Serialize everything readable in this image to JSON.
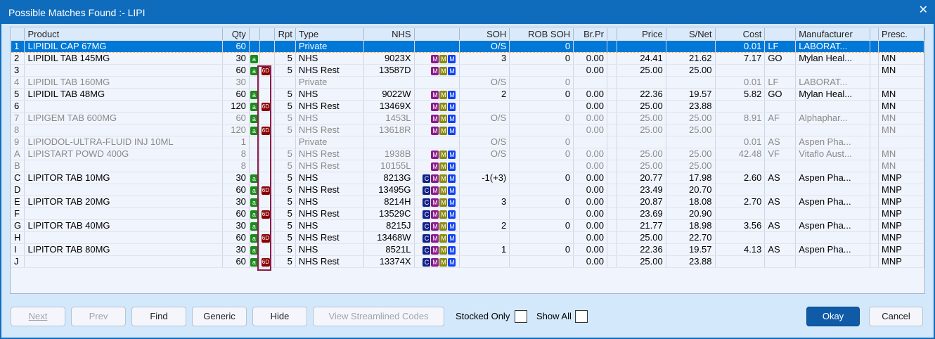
{
  "window": {
    "title": "Possible Matches Found :- LIPI",
    "close": "✕"
  },
  "columns": [
    "",
    "Product",
    "Qty",
    "",
    "",
    "Rpt",
    "Type",
    "NHS",
    "",
    "SOH",
    "ROB SOH",
    "Br.Pr",
    "",
    "Price",
    "S/Net",
    "Cost",
    "",
    "Manufacturer",
    "",
    "Presc."
  ],
  "rows": [
    {
      "id": "1",
      "product": "LIPIDIL CAP 67MG",
      "qty": "60",
      "a": false,
      "sixd": false,
      "rpt": "",
      "type": "Private",
      "nhs": "",
      "icons": "",
      "soh": "O/S",
      "rob": "0",
      "brpr": "",
      "price": "",
      "snet": "",
      "cost": "0.01",
      "code": "LF",
      "mfr": "LABORAT...",
      "presc": "",
      "state": "selected"
    },
    {
      "id": "2",
      "product": "LIPIDIL TAB 145MG",
      "qty": "30",
      "a": true,
      "sixd": false,
      "rpt": "5",
      "type": "NHS",
      "nhs": "9023X",
      "icons": "MMM",
      "soh": "3",
      "rob": "0",
      "brpr": "0.00",
      "price": "24.41",
      "snet": "21.62",
      "cost": "7.17",
      "code": "GO",
      "mfr": "Mylan Heal...",
      "presc": "MN",
      "state": ""
    },
    {
      "id": "3",
      "product": "",
      "qty": "60",
      "a": true,
      "sixd": true,
      "rpt": "5",
      "type": "NHS  Rest",
      "nhs": "13587D",
      "icons": "MMM",
      "soh": "",
      "rob": "",
      "brpr": "0.00",
      "price": "25.00",
      "snet": "25.00",
      "cost": "",
      "code": "",
      "mfr": "",
      "presc": "MN",
      "state": ""
    },
    {
      "id": "4",
      "product": "LIPIDIL TAB 160MG",
      "qty": "30",
      "a": false,
      "sixd": false,
      "rpt": "",
      "type": "Private",
      "nhs": "",
      "icons": "",
      "soh": "O/S",
      "rob": "0",
      "brpr": "",
      "price": "",
      "snet": "",
      "cost": "0.01",
      "code": "LF",
      "mfr": "LABORAT...",
      "presc": "",
      "state": "grey"
    },
    {
      "id": "5",
      "product": "LIPIDIL TAB 48MG",
      "qty": "60",
      "a": true,
      "sixd": false,
      "rpt": "5",
      "type": "NHS",
      "nhs": "9022W",
      "icons": "MMM",
      "soh": "2",
      "rob": "0",
      "brpr": "0.00",
      "price": "22.36",
      "snet": "19.57",
      "cost": "5.82",
      "code": "GO",
      "mfr": "Mylan Heal...",
      "presc": "MN",
      "state": ""
    },
    {
      "id": "6",
      "product": "",
      "qty": "120",
      "a": true,
      "sixd": true,
      "rpt": "5",
      "type": "NHS  Rest",
      "nhs": "13469X",
      "icons": "MMM",
      "soh": "",
      "rob": "",
      "brpr": "0.00",
      "price": "25.00",
      "snet": "23.88",
      "cost": "",
      "code": "",
      "mfr": "",
      "presc": "MN",
      "state": ""
    },
    {
      "id": "7",
      "product": "LIPIGEM TAB 600MG",
      "qty": "60",
      "a": true,
      "sixd": false,
      "rpt": "5",
      "type": "NHS",
      "nhs": "1453L",
      "icons": "MMM",
      "soh": "O/S",
      "rob": "0",
      "brpr": "0.00",
      "price": "25.00",
      "snet": "25.00",
      "cost": "8.91",
      "code": "AF",
      "mfr": "Alphaphar...",
      "presc": "MN",
      "state": "grey"
    },
    {
      "id": "8",
      "product": "",
      "qty": "120",
      "a": true,
      "sixd": true,
      "rpt": "5",
      "type": "NHS  Rest",
      "nhs": "13618R",
      "icons": "MMM",
      "soh": "",
      "rob": "",
      "brpr": "0.00",
      "price": "25.00",
      "snet": "25.00",
      "cost": "",
      "code": "",
      "mfr": "",
      "presc": "MN",
      "state": "grey"
    },
    {
      "id": "9",
      "product": "LIPIODOL-ULTRA-FLUID INJ 10ML",
      "qty": "1",
      "a": false,
      "sixd": false,
      "rpt": "",
      "type": "Private",
      "nhs": "",
      "icons": "",
      "soh": "O/S",
      "rob": "0",
      "brpr": "",
      "price": "",
      "snet": "",
      "cost": "0.01",
      "code": "AS",
      "mfr": "Aspen Pha...",
      "presc": "",
      "state": "grey"
    },
    {
      "id": "A",
      "product": "LIPISTART POWD 400G",
      "qty": "8",
      "a": false,
      "sixd": false,
      "rpt": "5",
      "type": "NHS  Rest",
      "nhs": "1938B",
      "icons": "MMM",
      "soh": "O/S",
      "rob": "0",
      "brpr": "0.00",
      "price": "25.00",
      "snet": "25.00",
      "cost": "42.48",
      "code": "VF",
      "mfr": "Vitaflo Aust...",
      "presc": "MN",
      "state": "grey"
    },
    {
      "id": "B",
      "product": "",
      "qty": "8",
      "a": false,
      "sixd": false,
      "rpt": "5",
      "type": "NHS  Rest",
      "nhs": "10155L",
      "icons": "MMM",
      "soh": "",
      "rob": "",
      "brpr": "0.00",
      "price": "25.00",
      "snet": "25.00",
      "cost": "",
      "code": "",
      "mfr": "",
      "presc": "MN",
      "state": "grey"
    },
    {
      "id": "C",
      "product": "LIPITOR TAB 10MG",
      "qty": "30",
      "a": true,
      "sixd": false,
      "rpt": "5",
      "type": "NHS",
      "nhs": "8213G",
      "icons": "CMMM",
      "soh": "-1(+3)",
      "rob": "0",
      "brpr": "0.00",
      "price": "20.77",
      "snet": "17.98",
      "cost": "2.60",
      "code": "AS",
      "mfr": "Aspen Pha...",
      "presc": "MNP",
      "state": ""
    },
    {
      "id": "D",
      "product": "",
      "qty": "60",
      "a": true,
      "sixd": true,
      "rpt": "5",
      "type": "NHS  Rest",
      "nhs": "13495G",
      "icons": "CMMM",
      "soh": "",
      "rob": "",
      "brpr": "0.00",
      "price": "23.49",
      "snet": "20.70",
      "cost": "",
      "code": "",
      "mfr": "",
      "presc": "MNP",
      "state": ""
    },
    {
      "id": "E",
      "product": "LIPITOR TAB 20MG",
      "qty": "30",
      "a": true,
      "sixd": false,
      "rpt": "5",
      "type": "NHS",
      "nhs": "8214H",
      "icons": "CMMM",
      "soh": "3",
      "rob": "0",
      "brpr": "0.00",
      "price": "20.87",
      "snet": "18.08",
      "cost": "2.70",
      "code": "AS",
      "mfr": "Aspen Pha...",
      "presc": "MNP",
      "state": ""
    },
    {
      "id": "F",
      "product": "",
      "qty": "60",
      "a": true,
      "sixd": true,
      "rpt": "5",
      "type": "NHS  Rest",
      "nhs": "13529C",
      "icons": "CMMM",
      "soh": "",
      "rob": "",
      "brpr": "0.00",
      "price": "23.69",
      "snet": "20.90",
      "cost": "",
      "code": "",
      "mfr": "",
      "presc": "MNP",
      "state": ""
    },
    {
      "id": "G",
      "product": "LIPITOR TAB 40MG",
      "qty": "30",
      "a": true,
      "sixd": false,
      "rpt": "5",
      "type": "NHS",
      "nhs": "8215J",
      "icons": "CMMM",
      "soh": "2",
      "rob": "0",
      "brpr": "0.00",
      "price": "21.77",
      "snet": "18.98",
      "cost": "3.56",
      "code": "AS",
      "mfr": "Aspen Pha...",
      "presc": "MNP",
      "state": ""
    },
    {
      "id": "H",
      "product": "",
      "qty": "60",
      "a": true,
      "sixd": true,
      "rpt": "5",
      "type": "NHS  Rest",
      "nhs": "13468W",
      "icons": "CMMM",
      "soh": "",
      "rob": "",
      "brpr": "0.00",
      "price": "25.00",
      "snet": "22.70",
      "cost": "",
      "code": "",
      "mfr": "",
      "presc": "MNP",
      "state": ""
    },
    {
      "id": "I",
      "product": "LIPITOR TAB 80MG",
      "qty": "30",
      "a": true,
      "sixd": false,
      "rpt": "5",
      "type": "NHS",
      "nhs": "8521L",
      "icons": "CMMM",
      "soh": "1",
      "rob": "0",
      "brpr": "0.00",
      "price": "22.36",
      "snet": "19.57",
      "cost": "4.13",
      "code": "AS",
      "mfr": "Aspen Pha...",
      "presc": "MNP",
      "state": ""
    },
    {
      "id": "J",
      "product": "",
      "qty": "60",
      "a": true,
      "sixd": true,
      "rpt": "5",
      "type": "NHS  Rest",
      "nhs": "13374X",
      "icons": "CMMM",
      "soh": "",
      "rob": "",
      "brpr": "0.00",
      "price": "25.00",
      "snet": "23.88",
      "cost": "",
      "code": "",
      "mfr": "",
      "presc": "MNP",
      "state": ""
    }
  ],
  "badges": {
    "a": "a",
    "sixd": "6D",
    "C": "C",
    "M": "M"
  },
  "buttons": {
    "next": "Next",
    "prev": "Prev",
    "find": "Find",
    "generic": "Generic",
    "hide": "Hide",
    "streamlined": "View Streamlined Codes",
    "okay": "Okay",
    "cancel": "Cancel"
  },
  "checkboxes": {
    "stocked_only": "Stocked Only",
    "show_all": "Show All"
  }
}
